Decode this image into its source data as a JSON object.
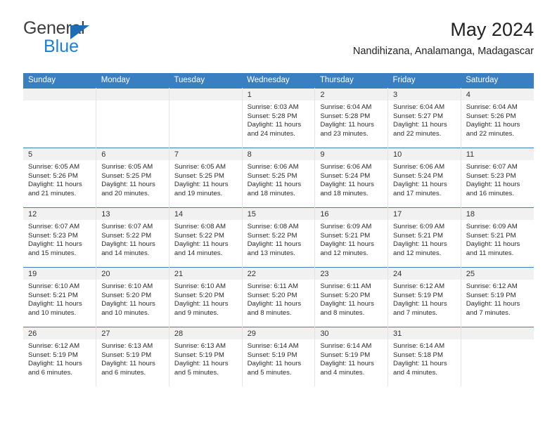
{
  "brand": {
    "line1": "General",
    "line2": "Blue",
    "triangle_color": "#1d6cb4",
    "blue_color": "#1d7fd0",
    "gray_color": "#3d3d3d"
  },
  "header": {
    "title": "May 2024",
    "subtitle": "Nandihizana, Analamanga, Madagascar"
  },
  "theme": {
    "header_bg": "#3a7fc1",
    "header_text": "#ffffff",
    "daynum_band_bg": "#f1f1f1",
    "cell_bg": "#ffffff",
    "row_divider": "#3a7fc1",
    "cell_divider": "#e4e4e4"
  },
  "weekdays": [
    "Sunday",
    "Monday",
    "Tuesday",
    "Wednesday",
    "Thursday",
    "Friday",
    "Saturday"
  ],
  "labels": {
    "sunrise_prefix": "Sunrise:",
    "sunset_prefix": "Sunset:",
    "daylight_prefix": "Daylight:"
  },
  "weeks": [
    [
      {
        "day": "",
        "lines": []
      },
      {
        "day": "",
        "lines": []
      },
      {
        "day": "",
        "lines": []
      },
      {
        "day": "1",
        "lines": [
          "Sunrise: 6:03 AM",
          "Sunset: 5:28 PM",
          "Daylight: 11 hours and 24 minutes."
        ]
      },
      {
        "day": "2",
        "lines": [
          "Sunrise: 6:04 AM",
          "Sunset: 5:28 PM",
          "Daylight: 11 hours and 23 minutes."
        ]
      },
      {
        "day": "3",
        "lines": [
          "Sunrise: 6:04 AM",
          "Sunset: 5:27 PM",
          "Daylight: 11 hours and 22 minutes."
        ]
      },
      {
        "day": "4",
        "lines": [
          "Sunrise: 6:04 AM",
          "Sunset: 5:26 PM",
          "Daylight: 11 hours and 22 minutes."
        ]
      }
    ],
    [
      {
        "day": "5",
        "lines": [
          "Sunrise: 6:05 AM",
          "Sunset: 5:26 PM",
          "Daylight: 11 hours and 21 minutes."
        ]
      },
      {
        "day": "6",
        "lines": [
          "Sunrise: 6:05 AM",
          "Sunset: 5:25 PM",
          "Daylight: 11 hours and 20 minutes."
        ]
      },
      {
        "day": "7",
        "lines": [
          "Sunrise: 6:05 AM",
          "Sunset: 5:25 PM",
          "Daylight: 11 hours and 19 minutes."
        ]
      },
      {
        "day": "8",
        "lines": [
          "Sunrise: 6:06 AM",
          "Sunset: 5:25 PM",
          "Daylight: 11 hours and 18 minutes."
        ]
      },
      {
        "day": "9",
        "lines": [
          "Sunrise: 6:06 AM",
          "Sunset: 5:24 PM",
          "Daylight: 11 hours and 18 minutes."
        ]
      },
      {
        "day": "10",
        "lines": [
          "Sunrise: 6:06 AM",
          "Sunset: 5:24 PM",
          "Daylight: 11 hours and 17 minutes."
        ]
      },
      {
        "day": "11",
        "lines": [
          "Sunrise: 6:07 AM",
          "Sunset: 5:23 PM",
          "Daylight: 11 hours and 16 minutes."
        ]
      }
    ],
    [
      {
        "day": "12",
        "lines": [
          "Sunrise: 6:07 AM",
          "Sunset: 5:23 PM",
          "Daylight: 11 hours and 15 minutes."
        ]
      },
      {
        "day": "13",
        "lines": [
          "Sunrise: 6:07 AM",
          "Sunset: 5:22 PM",
          "Daylight: 11 hours and 14 minutes."
        ]
      },
      {
        "day": "14",
        "lines": [
          "Sunrise: 6:08 AM",
          "Sunset: 5:22 PM",
          "Daylight: 11 hours and 14 minutes."
        ]
      },
      {
        "day": "15",
        "lines": [
          "Sunrise: 6:08 AM",
          "Sunset: 5:22 PM",
          "Daylight: 11 hours and 13 minutes."
        ]
      },
      {
        "day": "16",
        "lines": [
          "Sunrise: 6:09 AM",
          "Sunset: 5:21 PM",
          "Daylight: 11 hours and 12 minutes."
        ]
      },
      {
        "day": "17",
        "lines": [
          "Sunrise: 6:09 AM",
          "Sunset: 5:21 PM",
          "Daylight: 11 hours and 12 minutes."
        ]
      },
      {
        "day": "18",
        "lines": [
          "Sunrise: 6:09 AM",
          "Sunset: 5:21 PM",
          "Daylight: 11 hours and 11 minutes."
        ]
      }
    ],
    [
      {
        "day": "19",
        "lines": [
          "Sunrise: 6:10 AM",
          "Sunset: 5:21 PM",
          "Daylight: 11 hours and 10 minutes."
        ]
      },
      {
        "day": "20",
        "lines": [
          "Sunrise: 6:10 AM",
          "Sunset: 5:20 PM",
          "Daylight: 11 hours and 10 minutes."
        ]
      },
      {
        "day": "21",
        "lines": [
          "Sunrise: 6:10 AM",
          "Sunset: 5:20 PM",
          "Daylight: 11 hours and 9 minutes."
        ]
      },
      {
        "day": "22",
        "lines": [
          "Sunrise: 6:11 AM",
          "Sunset: 5:20 PM",
          "Daylight: 11 hours and 8 minutes."
        ]
      },
      {
        "day": "23",
        "lines": [
          "Sunrise: 6:11 AM",
          "Sunset: 5:20 PM",
          "Daylight: 11 hours and 8 minutes."
        ]
      },
      {
        "day": "24",
        "lines": [
          "Sunrise: 6:12 AM",
          "Sunset: 5:19 PM",
          "Daylight: 11 hours and 7 minutes."
        ]
      },
      {
        "day": "25",
        "lines": [
          "Sunrise: 6:12 AM",
          "Sunset: 5:19 PM",
          "Daylight: 11 hours and 7 minutes."
        ]
      }
    ],
    [
      {
        "day": "26",
        "lines": [
          "Sunrise: 6:12 AM",
          "Sunset: 5:19 PM",
          "Daylight: 11 hours and 6 minutes."
        ]
      },
      {
        "day": "27",
        "lines": [
          "Sunrise: 6:13 AM",
          "Sunset: 5:19 PM",
          "Daylight: 11 hours and 6 minutes."
        ]
      },
      {
        "day": "28",
        "lines": [
          "Sunrise: 6:13 AM",
          "Sunset: 5:19 PM",
          "Daylight: 11 hours and 5 minutes."
        ]
      },
      {
        "day": "29",
        "lines": [
          "Sunrise: 6:14 AM",
          "Sunset: 5:19 PM",
          "Daylight: 11 hours and 5 minutes."
        ]
      },
      {
        "day": "30",
        "lines": [
          "Sunrise: 6:14 AM",
          "Sunset: 5:19 PM",
          "Daylight: 11 hours and 4 minutes."
        ]
      },
      {
        "day": "31",
        "lines": [
          "Sunrise: 6:14 AM",
          "Sunset: 5:18 PM",
          "Daylight: 11 hours and 4 minutes."
        ]
      },
      {
        "day": "",
        "lines": []
      }
    ]
  ]
}
